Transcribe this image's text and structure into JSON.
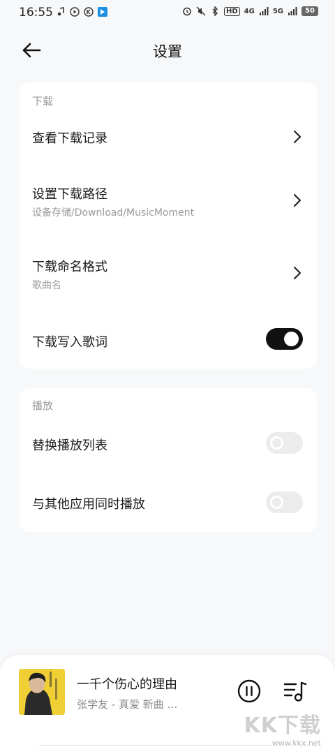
{
  "status_bar": {
    "time": "16:55",
    "left_icons": [
      "music-note-icon",
      "play-circle-icon",
      "k-circle-icon",
      "app-icon"
    ],
    "right_icons": [
      "alarm-icon",
      "mute-icon",
      "bluetooth-icon",
      "hd-icon",
      "signal-4g-icon",
      "signal-5g-icon"
    ],
    "hd_label": "HD",
    "net1_label": "4G",
    "net2_label": "5G",
    "battery": "50"
  },
  "header": {
    "title": "设置",
    "back_icon": "arrow-left-icon"
  },
  "download_section": {
    "label": "下载",
    "view_history": "查看下载记录",
    "set_path": "设置下载路径",
    "path_value": "设备存储/Download/MusicMoment",
    "naming_format": "下载命名格式",
    "naming_value": "歌曲名",
    "write_lyrics": "下载写入歌词",
    "write_lyrics_on": true
  },
  "play_section": {
    "label": "播放",
    "replace_playlist": "替换播放列表",
    "replace_playlist_on": false,
    "play_with_others": "与其他应用同时播放",
    "play_with_others_on": false
  },
  "player": {
    "song_title": "一千个伤心的理由",
    "artist_line": "张学友  -  真爱  新曲  …",
    "pause_icon": "pause-circle-icon",
    "playlist_icon": "playlist-music-icon"
  },
  "watermark": {
    "main": "KK下载",
    "url": "www.kkx.net"
  },
  "colors": {
    "background": "#f7f8fa",
    "card": "#ffffff",
    "toggle_on": "#111111",
    "toggle_off": "#ececec",
    "secondary_text": "#9b9b9b"
  }
}
